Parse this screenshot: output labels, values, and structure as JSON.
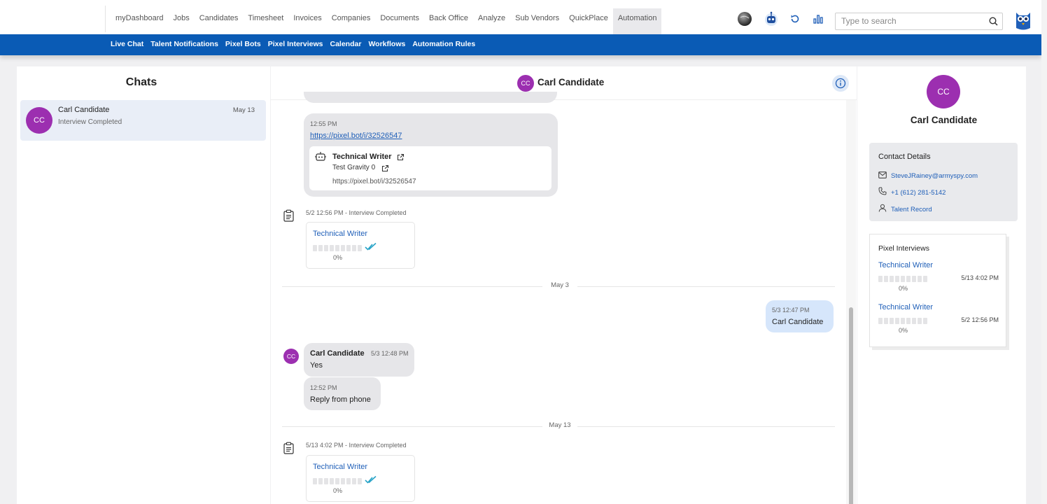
{
  "nav": {
    "items": [
      "myDashboard",
      "Jobs",
      "Candidates",
      "Timesheet",
      "Invoices",
      "Companies",
      "Documents",
      "Back Office",
      "Analyze",
      "Sub Vendors",
      "QuickPlace",
      "Automation"
    ],
    "active": "Automation"
  },
  "search": {
    "placeholder": "Type to search"
  },
  "subnav": {
    "items": [
      "Live Chat",
      "Talent Notifications",
      "Pixel Bots",
      "Pixel Interviews",
      "Calendar",
      "Workflows",
      "Automation Rules"
    ]
  },
  "chats": {
    "title": "Chats",
    "items": [
      {
        "initials": "CC",
        "name": "Carl Candidate",
        "status": "Interview Completed",
        "date": "May 13"
      }
    ]
  },
  "conversation": {
    "initials": "CC",
    "title": "Carl Candidate",
    "link_message": {
      "time": "12:55 PM",
      "url": "https://pixel.bot/i/32526547",
      "card_title": "Technical Writer",
      "card_sub": "Test Gravity 0",
      "card_url": "https://pixel.bot/i/32526547"
    },
    "event1": {
      "time": "5/2 12:56 PM - Interview Completed",
      "title": "Technical Writer",
      "percent": "0%"
    },
    "sep1": "May 3",
    "outgoing": {
      "time": "5/3 12:47 PM",
      "text": "Carl Candidate"
    },
    "incoming1": {
      "initials": "CC",
      "sender": "Carl Candidate",
      "time": "5/3 12:48 PM",
      "text": "Yes"
    },
    "incoming2": {
      "time": "12:52 PM",
      "text": "Reply from phone"
    },
    "sep2": "May 13",
    "event2": {
      "time": "5/13 4:02 PM - Interview Completed",
      "title": "Technical Writer",
      "percent": "0%"
    }
  },
  "profile": {
    "initials": "CC",
    "name": "Carl Candidate",
    "contact_header": "Contact Details",
    "email": "SteveJRainey@armyspy.com",
    "phone": "+1 (612) 281-5142",
    "record": "Talent Record",
    "pixel_header": "Pixel Interviews",
    "interviews": [
      {
        "title": "Technical Writer",
        "percent": "0%",
        "date": "5/13 4:02 PM"
      },
      {
        "title": "Technical Writer",
        "percent": "0%",
        "date": "5/2 12:56 PM"
      }
    ]
  },
  "colors": {
    "brand_blue": "#0a5bb5",
    "avatar_purple": "#9c2fb0",
    "link_blue": "#1f5fb8",
    "outgoing_bubble": "#d6e6fb"
  }
}
